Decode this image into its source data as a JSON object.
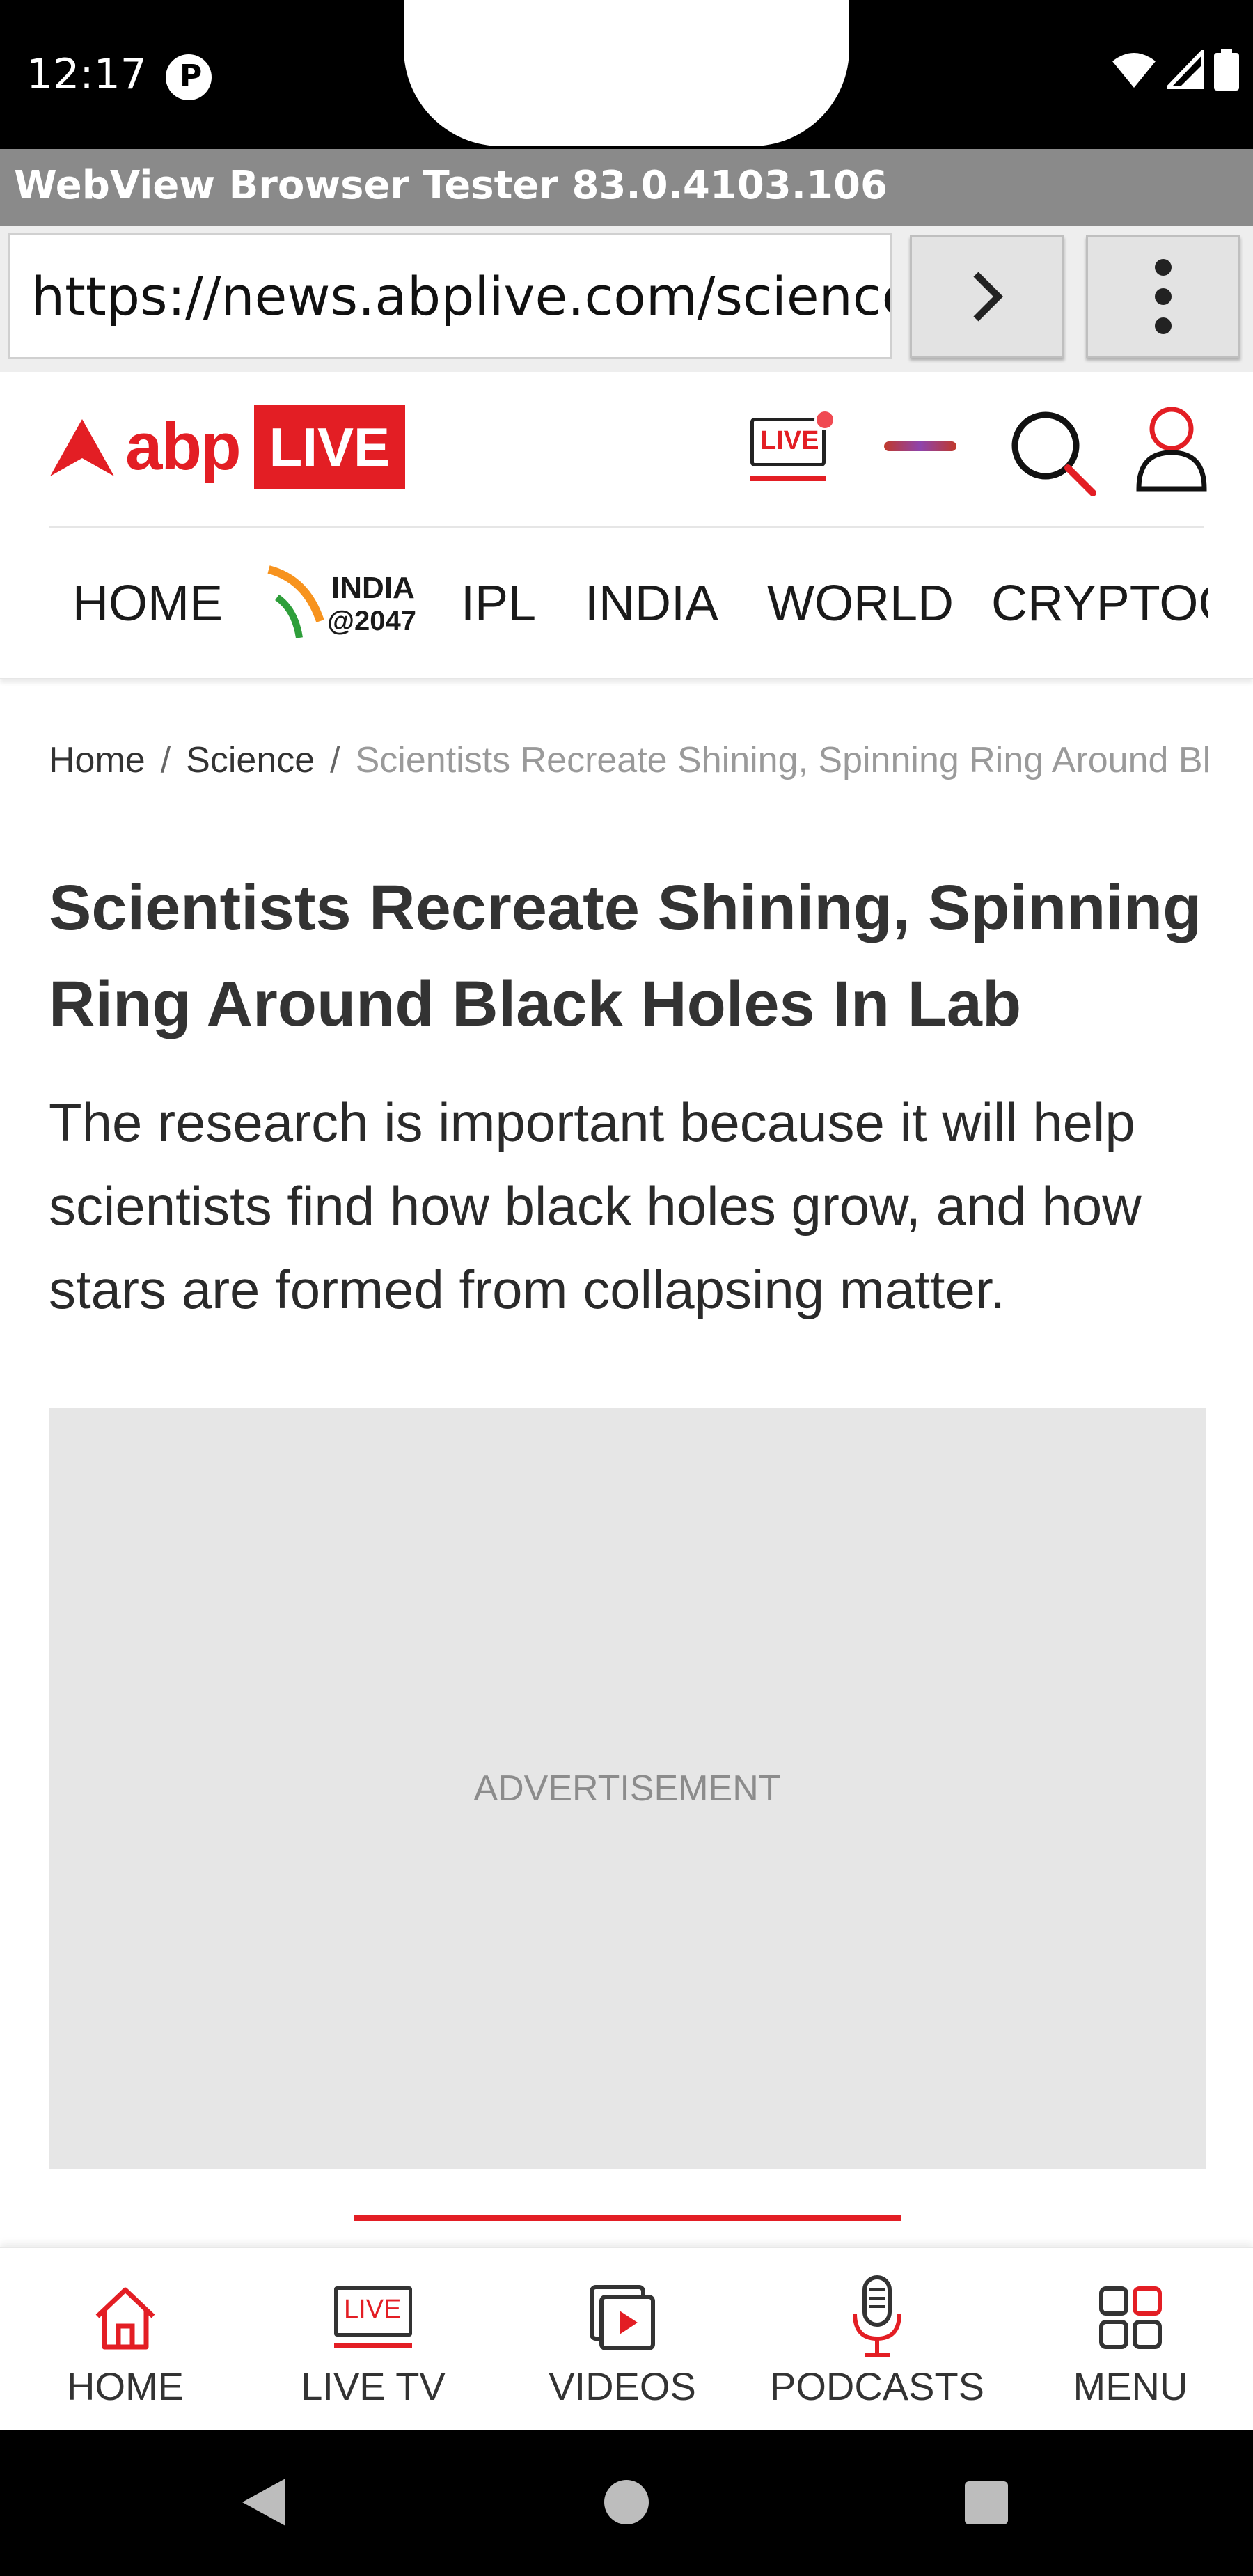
{
  "status_bar": {
    "time": "12:17",
    "app_icon_letter": "P"
  },
  "webview": {
    "title": "WebView Browser Tester 83.0.4103.106"
  },
  "url_bar": {
    "url": "https://news.abplive.com/science/"
  },
  "site": {
    "logo_text": "abp",
    "logo_badge": "LIVE",
    "live_icon_label": "LIVE",
    "brand_red": "#e31e24"
  },
  "nav": {
    "items": [
      "HOME",
      "IPL",
      "INDIA",
      "WORLD",
      "CRYPTOCURRENCY"
    ],
    "india_badge_top": "INDIA",
    "india_badge_bottom": "@2047"
  },
  "breadcrumb": [
    "Home",
    "Science",
    "Scientists Recreate Shining, Spinning Ring Around Black Holes In Lab"
  ],
  "article": {
    "headline": "Scientists Recreate Shining, Spinning Ring Around Black Holes In Lab",
    "summary": "The research is important because it will help scientists find how black holes grow, and how stars are formed from collapsing matter."
  },
  "ad": {
    "label": "ADVERTISEMENT"
  },
  "bottom_nav": {
    "items": [
      {
        "label": "HOME",
        "icon": "home-icon"
      },
      {
        "label": "LIVE TV",
        "icon": "live-tv-icon",
        "badge": "LIVE"
      },
      {
        "label": "VIDEOS",
        "icon": "videos-icon"
      },
      {
        "label": "PODCASTS",
        "icon": "microphone-icon"
      },
      {
        "label": "MENU",
        "icon": "grid-menu-icon"
      }
    ]
  }
}
